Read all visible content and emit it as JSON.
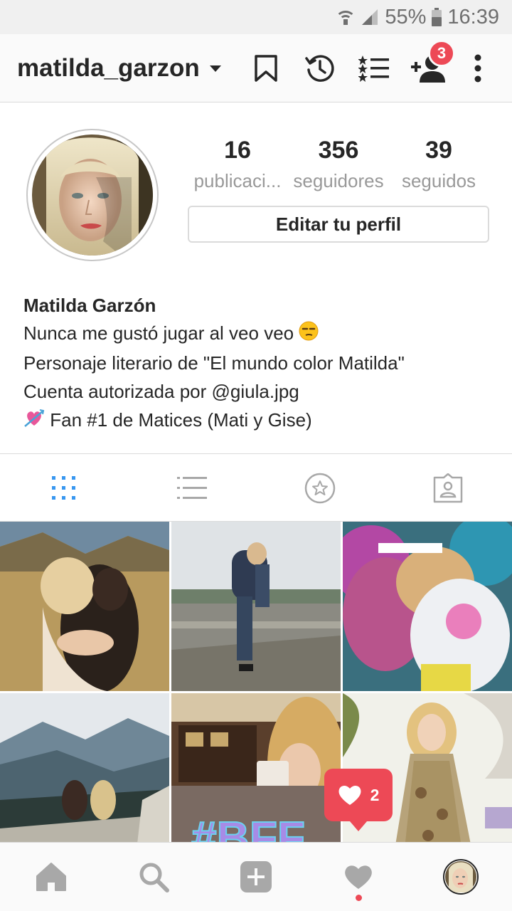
{
  "status_bar": {
    "battery": "55%",
    "time": "16:39"
  },
  "header": {
    "username": "matilda_garzon",
    "notification_badge": "3"
  },
  "profile": {
    "stats": [
      {
        "value": "16",
        "label": "publicaci..."
      },
      {
        "value": "356",
        "label": "seguidores"
      },
      {
        "value": "39",
        "label": "seguidos"
      }
    ],
    "edit_button": "Editar tu perfil"
  },
  "bio": {
    "name": "Matilda Garzón",
    "line1": "Nunca me gustó jugar al veo veo",
    "line2": "Personaje literario de \"El mundo color Matilda\"",
    "line3": "Cuenta autorizada por @giula.jpg",
    "line4": "Fan #1 de Matices (Mati y Gise)"
  },
  "tabs": [
    {
      "icon": "grid-icon",
      "active": true
    },
    {
      "icon": "list-icon",
      "active": false
    },
    {
      "icon": "star-icon",
      "active": false
    },
    {
      "icon": "tagged-icon",
      "active": false
    }
  ],
  "grid_overlay_text": "#BFF",
  "activity_popup": {
    "likes": "2"
  },
  "bottom_nav": [
    "home-icon",
    "search-icon",
    "add-icon",
    "heart-icon",
    "profile-avatar"
  ],
  "colors": {
    "accent_blue": "#3897f0",
    "badge_red": "#ed4956",
    "text": "#262626",
    "muted": "#999999"
  }
}
